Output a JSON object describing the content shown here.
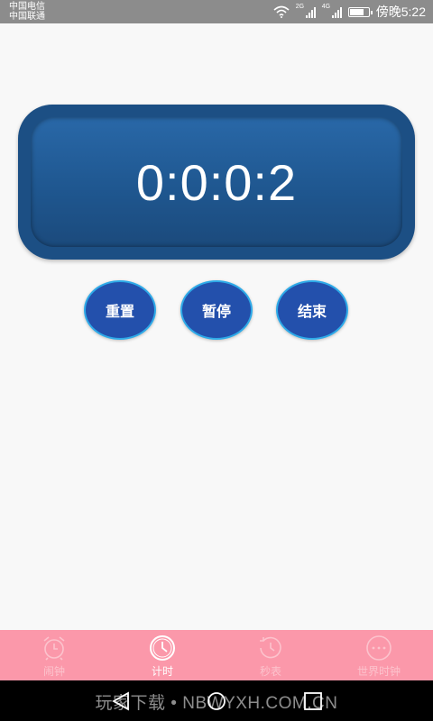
{
  "status_bar": {
    "carrier_1": "中国电信",
    "carrier_2": "中国联通",
    "network_1": "2G",
    "network_2": "4G",
    "time": "傍晚5:22",
    "battery_level": 0.75
  },
  "timer": {
    "display": "0:0:0:2"
  },
  "controls": {
    "reset_label": "重置",
    "pause_label": "暂停",
    "stop_label": "结束"
  },
  "tabs": [
    {
      "label": "闹钟",
      "icon": "alarm-clock-icon",
      "active": false
    },
    {
      "label": "计时",
      "icon": "clock-icon",
      "active": true
    },
    {
      "label": "秒表",
      "icon": "stopwatch-icon",
      "active": false
    },
    {
      "label": "世界时钟",
      "icon": "more-icon",
      "active": false
    }
  ],
  "watermark": "玩家下载 • NBWYXH.COM.CN",
  "colors": {
    "status_bar": "#8c8c8c",
    "timer_outer": "#1c4f84",
    "timer_inner": "#2464a4",
    "button_fill": "#2350ac",
    "button_border": "#2eaae8",
    "tab_bar": "#fb98aa",
    "tab_inactive": "#fcc3cd",
    "tab_active": "#ffffff"
  }
}
